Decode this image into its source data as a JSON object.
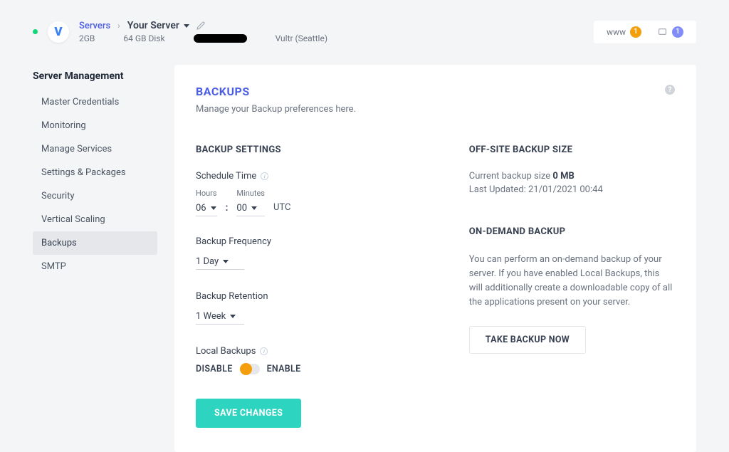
{
  "breadcrumb": {
    "root": "Servers",
    "current": "Your Server"
  },
  "server_stats": {
    "ram": "2GB",
    "disk": "64 GB Disk",
    "provider": "Vultr (Seattle)"
  },
  "top_badges": {
    "www_label": "www",
    "www_count": "1",
    "apps_count": "1"
  },
  "sidebar": {
    "title": "Server Management",
    "items": [
      {
        "label": "Master Credentials"
      },
      {
        "label": "Monitoring"
      },
      {
        "label": "Manage Services"
      },
      {
        "label": "Settings & Packages"
      },
      {
        "label": "Security"
      },
      {
        "label": "Vertical Scaling"
      },
      {
        "label": "Backups"
      },
      {
        "label": "SMTP"
      }
    ],
    "active_index": 6
  },
  "card": {
    "title": "BACKUPS",
    "subtitle": "Manage your Backup preferences here."
  },
  "settings": {
    "section_label": "BACKUP SETTINGS",
    "schedule_label": "Schedule Time",
    "hours_label": "Hours",
    "hours_value": "06",
    "minutes_label": "Minutes",
    "minutes_value": "00",
    "tz": "UTC",
    "frequency_label": "Backup Frequency",
    "frequency_value": "1 Day",
    "retention_label": "Backup Retention",
    "retention_value": "1 Week",
    "local_label": "Local Backups",
    "disable": "DISABLE",
    "enable": "ENABLE",
    "save_btn": "SAVE CHANGES"
  },
  "offsite": {
    "section_label": "OFF-SITE BACKUP SIZE",
    "size_prefix": "Current backup size ",
    "size_value": "0 MB",
    "updated": "Last Updated: 21/01/2021 00:44"
  },
  "ondemand": {
    "section_label": "ON-DEMAND BACKUP",
    "desc": "You can perform an on-demand backup of your server. If you have enabled Local Backups, this will additionally create a downloadable copy of all the applications present on your server.",
    "btn": "TAKE BACKUP NOW"
  }
}
